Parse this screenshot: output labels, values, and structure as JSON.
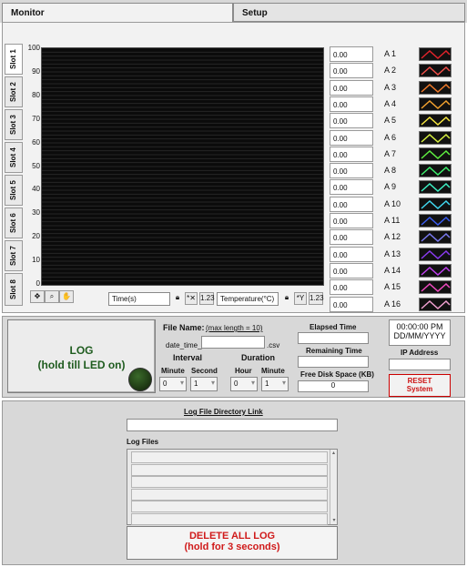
{
  "tabs": [
    {
      "label": "Monitor",
      "active": true
    },
    {
      "label": "Setup",
      "active": false
    }
  ],
  "slot_tabs": [
    "Slot 1",
    "Slot 2",
    "Slot 3",
    "Slot 4",
    "Slot 5",
    "Slot 6",
    "Slot 7",
    "Slot 8"
  ],
  "chart": {
    "y_ticks": [
      "100",
      "90",
      "80",
      "70",
      "60",
      "50",
      "40",
      "30",
      "20",
      "10",
      "0"
    ],
    "x_axis_label": "Time(s)",
    "y_axis_label": "Temperature(°C)",
    "scale_x_label": "1.23",
    "scale_y_label": "1.23"
  },
  "channels": [
    {
      "label": "A 1",
      "value": "0.00",
      "color": "#e0232a"
    },
    {
      "label": "A 2",
      "value": "0.00",
      "color": "#f0504a"
    },
    {
      "label": "A 3",
      "value": "0.00",
      "color": "#f07a2a"
    },
    {
      "label": "A 4",
      "value": "0.00",
      "color": "#f2a12e"
    },
    {
      "label": "A 5",
      "value": "0.00",
      "color": "#f6e640"
    },
    {
      "label": "A 6",
      "value": "0.00",
      "color": "#d8f040"
    },
    {
      "label": "A 7",
      "value": "0.00",
      "color": "#5ef040"
    },
    {
      "label": "A 8",
      "value": "0.00",
      "color": "#3ef06e"
    },
    {
      "label": "A 9",
      "value": "0.00",
      "color": "#3ef0c4"
    },
    {
      "label": "A 10",
      "value": "0.00",
      "color": "#40d8f0"
    },
    {
      "label": "A 11",
      "value": "0.00",
      "color": "#3a5cf0"
    },
    {
      "label": "A 12",
      "value": "0.00",
      "color": "#7a7af0"
    },
    {
      "label": "A 13",
      "value": "0.00",
      "color": "#8a3af0"
    },
    {
      "label": "A 14",
      "value": "0.00",
      "color": "#c040f0"
    },
    {
      "label": "A 15",
      "value": "0.00",
      "color": "#f04ac0"
    },
    {
      "label": "A 16",
      "value": "0.00",
      "color": "#f0a0d0"
    }
  ],
  "log_button": {
    "line1": "LOG",
    "line2": "(hold till LED on)"
  },
  "file_name": {
    "label": "File Name:",
    "hint": "(max length = 10)",
    "prefix": "date_time_",
    "value": "",
    "suffix": ".csv"
  },
  "interval": {
    "title": "Interval",
    "minute_label": "Minute",
    "second_label": "Second",
    "minute_value": "0",
    "second_value": "1"
  },
  "duration": {
    "title": "Duration",
    "hour_label": "Hour",
    "minute_label": "Minute",
    "hour_value": "0",
    "minute_value": "1"
  },
  "elapsed_time": {
    "label": "Elapsed Time",
    "value": ""
  },
  "remaining_time": {
    "label": "Remaining Time",
    "value": ""
  },
  "free_disk": {
    "label": "Free Disk Space (KB)",
    "value": "0"
  },
  "clock": {
    "time": "00:00:00 PM",
    "date": "DD/MM/YYYY"
  },
  "ip_address": {
    "label": "IP Address",
    "value": ""
  },
  "reset_button": {
    "line1": "RESET",
    "line2": "System"
  },
  "log_directory": {
    "label": "Log File Directory Link",
    "value": ""
  },
  "log_files": {
    "label": "Log Files",
    "items": [
      "",
      "",
      "",
      "",
      "",
      ""
    ]
  },
  "delete_button": {
    "line1": "DELETE ALL LOG",
    "line2": "(hold for 3 seconds)"
  }
}
